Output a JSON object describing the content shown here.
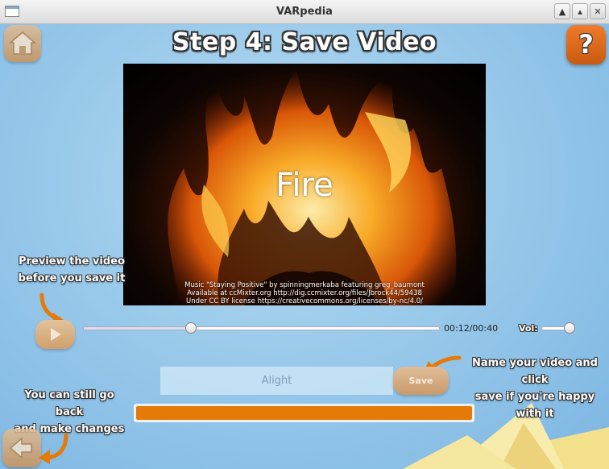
{
  "window": {
    "title": "VARpedia",
    "controls": {
      "up": "▲",
      "maximize": "▴",
      "close": "✕"
    }
  },
  "header": {
    "title": "Step 4: Save Video",
    "help_label": "?",
    "home_icon": "home-icon"
  },
  "video": {
    "caption": "Fire",
    "credits": [
      "Music \"Staying Positive\" by spinningmerkaba featuring greg_baumont",
      "Available at ccMixter.org http://dig.ccmixter.org/files/Jbrock44/59438",
      "Under CC BY license https://creativecommons.org/licenses/by-nc/4.0/"
    ]
  },
  "hints": {
    "preview": [
      "Preview the video",
      "before you save it"
    ],
    "name": [
      "Name your video and click",
      "save if you're happy with it"
    ],
    "back": [
      "You can still go back",
      "and make changes"
    ]
  },
  "player": {
    "time": "00:12/00:40",
    "position": 0.3,
    "volume_label": "Vol:",
    "volume": 0.85,
    "play_icon": "play-icon"
  },
  "save_form": {
    "name_value": "Alight",
    "save_label": "Save"
  },
  "progress": {
    "value": 1.0
  },
  "colors": {
    "accent": "#e67a09",
    "help_button": "#e06a18",
    "background": "#9ccbeb"
  }
}
